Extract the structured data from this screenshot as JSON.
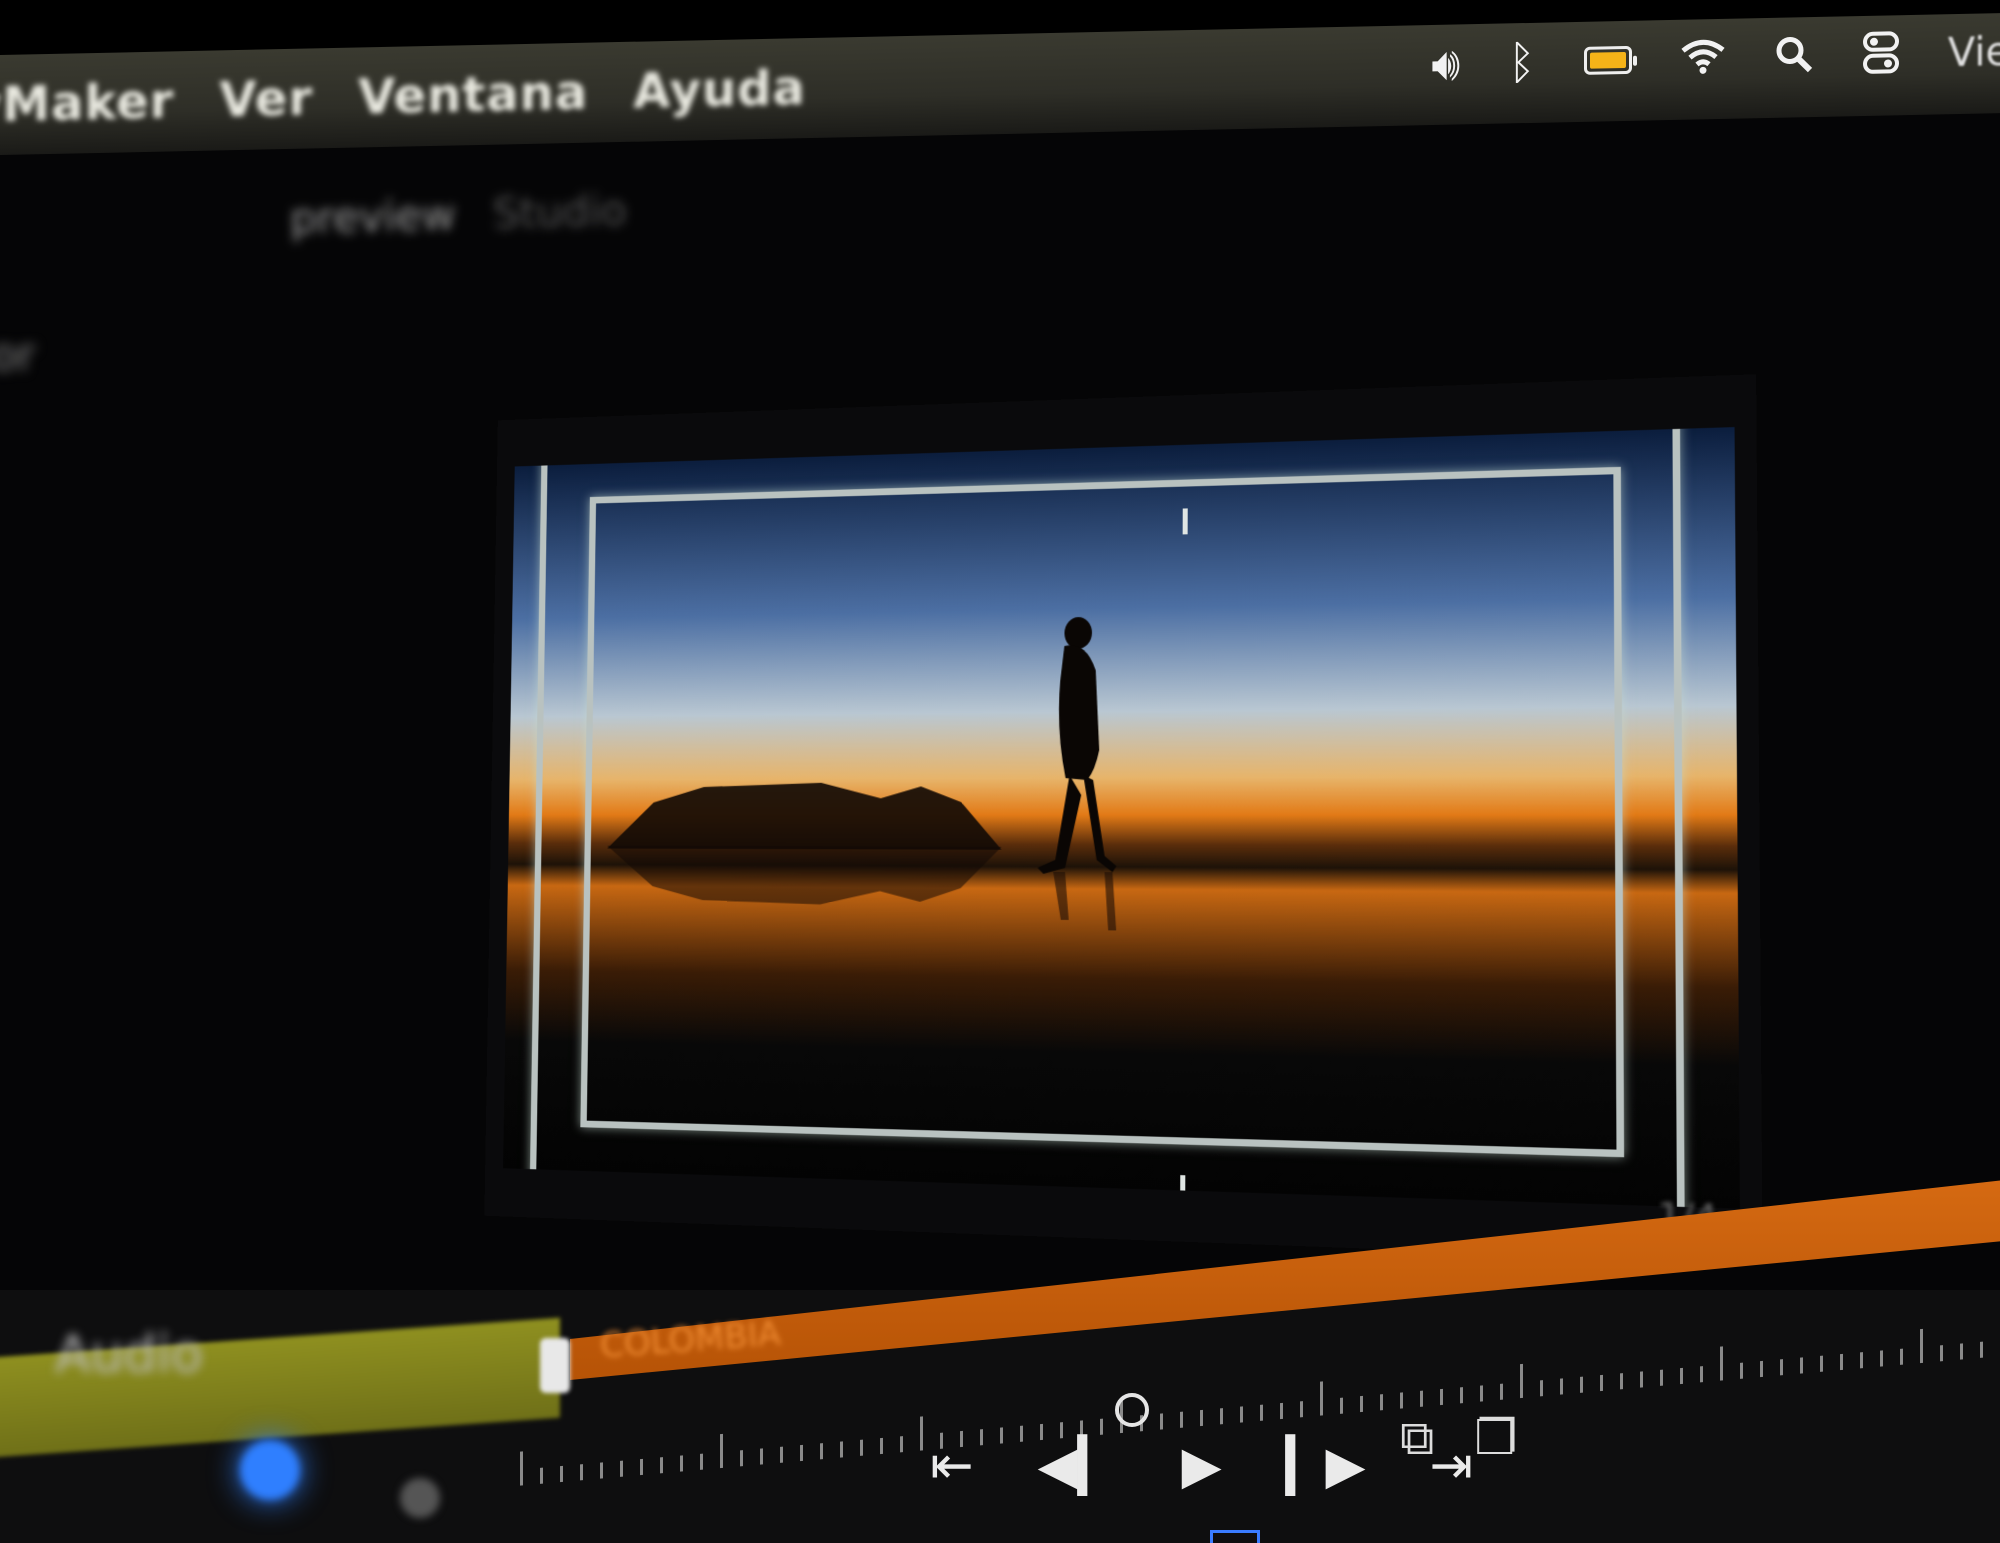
{
  "menubar": {
    "app_name": "yMaker",
    "items": [
      "Ver",
      "Ventana",
      "Ayuda"
    ],
    "status_icons": [
      "volume-icon",
      "bluetooth-icon",
      "battery-icon",
      "wifi-icon",
      "search-icon",
      "control-center-icon"
    ],
    "battery_color": "#f5b318",
    "clock_partial": "Vie"
  },
  "panel": {
    "title": "preview",
    "subtitle": "Studio",
    "side_label": "or"
  },
  "viewer": {
    "fps_label": "1/4"
  },
  "timeline": {
    "audio_track_label": "Audio",
    "clip_label": "COLOMBIA",
    "accent_orange": "#d66a12",
    "accent_green": "#8f9020"
  },
  "transport": {
    "go_to_start": "⇤",
    "step_back": "◀▎",
    "play": "▶",
    "step_forward": "▎▶",
    "go_to_end": "⇥"
  },
  "tools": {
    "tool_a": "⧉",
    "tool_b": "❐"
  }
}
